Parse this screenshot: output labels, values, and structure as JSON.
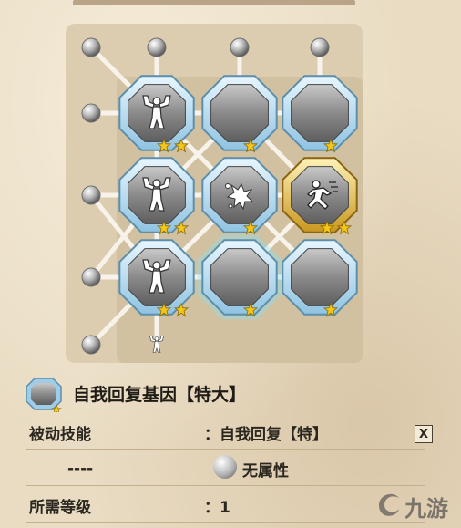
{
  "skill": {
    "name": "自我回复基因【特大】",
    "type_label": "被动技能",
    "type_value": "：自我回复【特】",
    "element_label": "----",
    "element_value": "无属性",
    "level_label": "所需等级",
    "level_value": "：1",
    "close_label": "X"
  },
  "watermark": "九游",
  "colors": {
    "background": "#e9dcc3",
    "node_frame": "#a9cfe6",
    "gold_frame": "#e0b84a",
    "star": "#f5c518"
  },
  "grid": {
    "rows": [
      [
        {
          "icon": "muscle-icon",
          "stars": 2
        },
        {
          "icon": "empty",
          "stars": 1
        },
        {
          "icon": "empty",
          "stars": 1
        }
      ],
      [
        {
          "icon": "muscle-icon",
          "stars": 2
        },
        {
          "icon": "burst-icon",
          "stars": 1
        },
        {
          "icon": "running-icon",
          "stars": 2,
          "unlocked": true
        }
      ],
      [
        {
          "icon": "muscle-icon",
          "stars": 2
        },
        {
          "icon": "empty",
          "stars": 1,
          "selected": true
        },
        {
          "icon": "empty",
          "stars": 1
        }
      ]
    ]
  }
}
